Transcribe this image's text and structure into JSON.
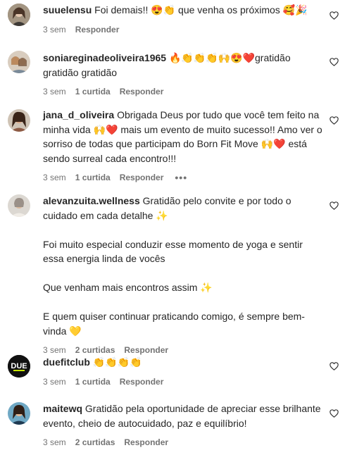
{
  "comments": [
    {
      "username": "suuelensu",
      "text": "Foi demais!! 😍👏 que venha os próximos 🥰🎉",
      "time": "3 sem",
      "likes": "",
      "reply": "Responder",
      "avatar_color": "#8a7a66"
    },
    {
      "username": "soniareginadeoliveira1965",
      "text": "🔥👏👏👏🙌😍❤️gratidão gratidão gratidão",
      "time": "3 sem",
      "likes": "1 curtida",
      "reply": "Responder",
      "avatar_color": "#b89c80"
    },
    {
      "username": "jana_d_oliveira",
      "text": "Obrigada Deus por tudo que você tem feito na minha vida 🙌❤️ mais um evento de muito sucesso!! Amo ver o sorriso de todas que participam do Born Fit Move 🙌❤️ está sendo surreal cada encontro!!!",
      "time": "3 sem",
      "likes": "1 curtida",
      "reply": "Responder",
      "more": "•••",
      "avatar_color": "#a06b4e"
    },
    {
      "username": "alevanzuita.wellness",
      "text": "Gratidão pelo convite e por todo o cuidado em cada detalhe ✨\n\nFoi muito especial conduzir esse momento de yoga e sentir essa energia linda de vocês\n\nQue venham mais encontros assim ✨\n\nE quem quiser continuar praticando comigo, é sempre bem-vinda 💛",
      "time": "3 sem",
      "likes": "2 curtidas",
      "reply": "Responder",
      "avatar_color": "#c8c2ba"
    },
    {
      "username": "duefitclub",
      "text": "👏👏👏👏",
      "time": "3 sem",
      "likes": "1 curtida",
      "reply": "Responder",
      "avatar_color": "#111111"
    },
    {
      "username": "maitewq",
      "text": "Gratidão pela oportunidade de apreciar esse brilhante evento, cheio de autocuidado, paz e equilíbrio!",
      "time": "3 sem",
      "likes": "2 curtidas",
      "reply": "Responder",
      "avatar_color": "#3d6f8a"
    }
  ],
  "avatar_logo_text": "DUE"
}
